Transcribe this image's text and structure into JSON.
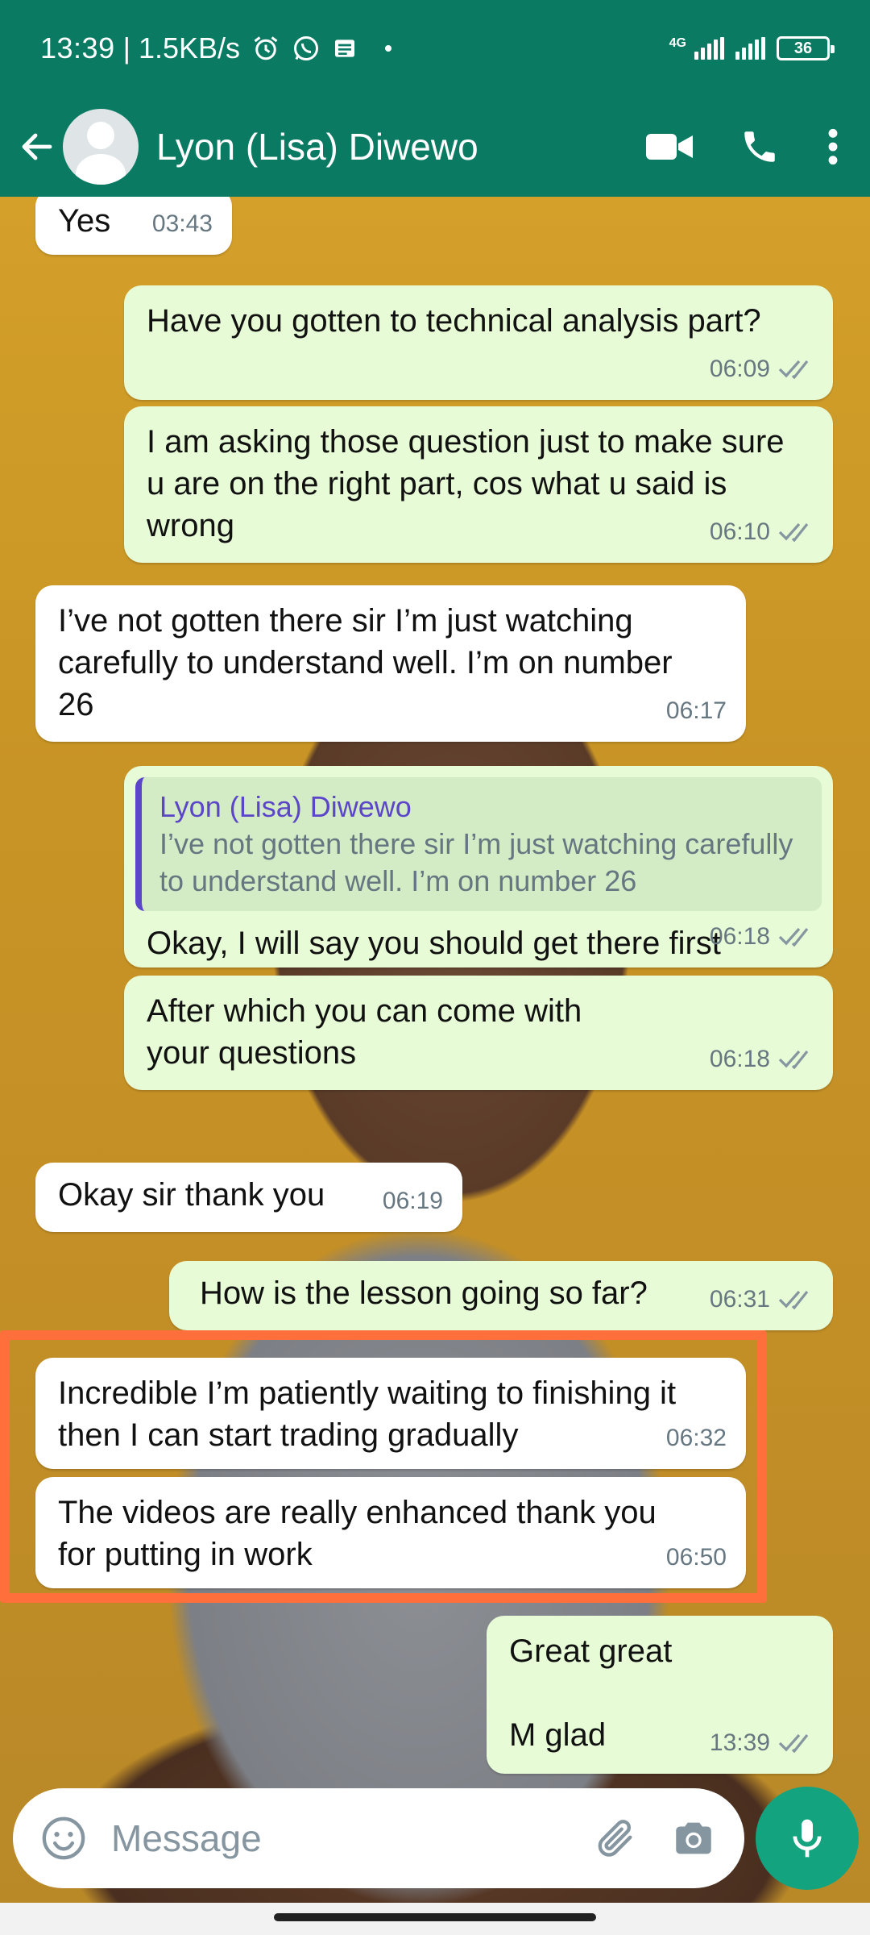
{
  "status_bar": {
    "time": "13:39",
    "speed": "| 1.5KB/s",
    "network": "4G",
    "battery": "36"
  },
  "header": {
    "contact_name": "Lyon (Lisa) Diwewo",
    "icons": [
      "back-arrow-icon",
      "avatar",
      "video-call-icon",
      "phone-icon",
      "more-vert-icon"
    ]
  },
  "messages": [
    {
      "dir": "in",
      "text": "Yes",
      "time": "03:43"
    },
    {
      "dir": "out",
      "text": "Have you gotten to technical analysis part?",
      "time": "06:09"
    },
    {
      "dir": "out",
      "text": "I am asking those question just to make sure u are on the right part, cos what u said is wrong",
      "time": "06:10"
    },
    {
      "dir": "in",
      "text": "I’ve not gotten there sir I’m just watching carefully to understand well. I’m on number 26",
      "time": "06:17"
    },
    {
      "dir": "out",
      "quote_name": "Lyon (Lisa) Diwewo",
      "quote_text": "I’ve not gotten there sir I’m just watching carefully to understand well. I’m on number 26",
      "text": "Okay, I will say you should get there first",
      "time": "06:18"
    },
    {
      "dir": "out",
      "text": "After which you can come with your questions",
      "time": "06:18"
    },
    {
      "dir": "in",
      "text": "Okay sir thank you",
      "time": "06:19"
    },
    {
      "dir": "out",
      "text": "How is the lesson going so far?",
      "time": "06:31"
    },
    {
      "dir": "in",
      "text": "Incredible I’m patiently waiting to finishing it then I can start trading gradually",
      "time": "06:32"
    },
    {
      "dir": "in",
      "text": "The videos are really enhanced thank you for putting in work",
      "time": "06:50"
    },
    {
      "dir": "out",
      "text": "Great great\n\nM glad",
      "time": "13:39"
    }
  ],
  "composer": {
    "placeholder": "Message"
  },
  "colors": {
    "header": "#0a7b62",
    "outgoing_bubble": "#e7fcd6",
    "incoming_bubble": "#ffffff",
    "highlight": "#ff6f3c",
    "mic_button": "#13a37f"
  }
}
